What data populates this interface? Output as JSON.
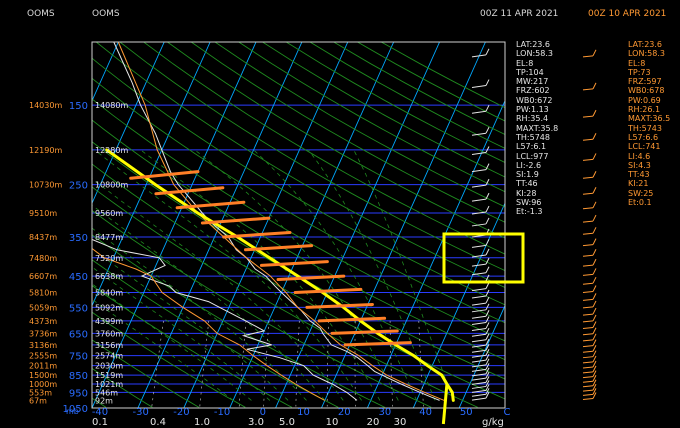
{
  "header": {
    "left_station_1": "OOMS",
    "left_station_2": "OOMS",
    "date_current": "00Z 11 APR 2021",
    "date_previous": "00Z 10 APR 2021"
  },
  "info_current": [
    "LAT:23.6",
    "LON:58.3",
    "EL:8",
    "TP:104",
    "MW:217",
    "FRZ:602",
    "WB0:672",
    "PW:1.13",
    "RH:35.4",
    "MAXT:35.8",
    "TH:5748",
    "L57:6.1",
    "LCL:977",
    "LI:-2.6",
    "SI:1.9",
    "TT:46",
    "KI:28",
    "SW:96",
    "Et:-1.3"
  ],
  "info_previous": [
    "LAT:23.6",
    "LON:58.3",
    "EL:8",
    "TP:73",
    "FRZ:597",
    "WB0:678",
    "PW:0.69",
    "RH:26.1",
    "MAXT:36.5",
    "TH:5743",
    "L57:6.6",
    "LCL:741",
    "LI:4.6",
    "SI:4.3",
    "TT:43",
    "KI:21",
    "SW:25",
    "Et:0.1"
  ],
  "colors": {
    "background": "#000000",
    "isobars": "#2a3cff",
    "isotherms": "#00a8ff",
    "dry_adiabats": "#1f8a1f",
    "moist_adiabats": "#1f8a1f",
    "current_profile": "#e6e6e6",
    "previous_profile": "#ff9933",
    "annotation_curve": "#ffff00",
    "annotation_hatch": "#ff7f27",
    "annotation_box": "#ffff00"
  },
  "chart_data": {
    "type": "line",
    "title": "",
    "pressure_units": "mb",
    "pressure_levels": [
      100,
      150,
      200,
      250,
      300,
      350,
      400,
      450,
      500,
      550,
      600,
      650,
      700,
      750,
      800,
      850,
      900,
      950,
      1050
    ],
    "pressure_labels": [
      {
        "p": 150,
        "label": "150"
      },
      {
        "p": 250,
        "label": "250"
      },
      {
        "p": 350,
        "label": "350"
      },
      {
        "p": 450,
        "label": "450"
      },
      {
        "p": 550,
        "label": "550"
      },
      {
        "p": 650,
        "label": "650"
      },
      {
        "p": 750,
        "label": "750"
      },
      {
        "p": 850,
        "label": "850"
      },
      {
        "p": 950,
        "label": "950"
      },
      {
        "p": 1050,
        "label": "1050"
      }
    ],
    "height_labels_previous": [
      {
        "p": 150,
        "label": "14030m"
      },
      {
        "p": 200,
        "label": "12190m"
      },
      {
        "p": 250,
        "label": "10730m"
      },
      {
        "p": 300,
        "label": "9510m"
      },
      {
        "p": 350,
        "label": "8437m"
      },
      {
        "p": 400,
        "label": "7480m"
      },
      {
        "p": 450,
        "label": "6607m"
      },
      {
        "p": 500,
        "label": "5810m"
      },
      {
        "p": 550,
        "label": "5059m"
      },
      {
        "p": 600,
        "label": "4373m"
      },
      {
        "p": 650,
        "label": "3736m"
      },
      {
        "p": 700,
        "label": "3136m"
      },
      {
        "p": 750,
        "label": "2555m"
      },
      {
        "p": 800,
        "label": "2011m"
      },
      {
        "p": 850,
        "label": "1500m"
      },
      {
        "p": 900,
        "label": "1000m"
      },
      {
        "p": 950,
        "label": "553m"
      },
      {
        "p": 1000,
        "label": "67m"
      }
    ],
    "height_labels_current": [
      {
        "p": 150,
        "label": "14080m"
      },
      {
        "p": 200,
        "label": "12280m"
      },
      {
        "p": 250,
        "label": "10800m"
      },
      {
        "p": 300,
        "label": "9560m"
      },
      {
        "p": 350,
        "label": "8477m"
      },
      {
        "p": 400,
        "label": "7520m"
      },
      {
        "p": 450,
        "label": "6638m"
      },
      {
        "p": 500,
        "label": "5840m"
      },
      {
        "p": 550,
        "label": "5092m"
      },
      {
        "p": 600,
        "label": "4399m"
      },
      {
        "p": 650,
        "label": "3760m"
      },
      {
        "p": 700,
        "label": "3156m"
      },
      {
        "p": 750,
        "label": "2574m"
      },
      {
        "p": 800,
        "label": "2030m"
      },
      {
        "p": 850,
        "label": "1519m"
      },
      {
        "p": 900,
        "label": "1021m"
      },
      {
        "p": 950,
        "label": "546m"
      },
      {
        "p": 1000,
        "label": "92m"
      }
    ],
    "temperature_ticks": [
      "-40",
      "-30",
      "-20",
      "-10",
      "0",
      "10",
      "20",
      "30",
      "40",
      "50",
      "C"
    ],
    "mixing_ratio_ticks": [
      "0.1",
      "0.4",
      "1.0",
      "3.0",
      "5.0",
      "10",
      "20",
      "30"
    ],
    "mixing_ratio_units": "g/kg",
    "temperature_range": [
      -40,
      50
    ],
    "pressure_range": [
      100,
      1050
    ],
    "skew_deg_per_decade": 35,
    "series": [
      {
        "name": "",
        "color_key": "current_profile",
        "kind": "temperature",
        "points": [
          [
            100,
            -71
          ],
          [
            130,
            -63
          ],
          [
            150,
            -59
          ],
          [
            180,
            -53
          ],
          [
            200,
            -50
          ],
          [
            230,
            -46
          ],
          [
            250,
            -43
          ],
          [
            280,
            -38
          ],
          [
            300,
            -35
          ],
          [
            320,
            -32
          ],
          [
            350,
            -27
          ],
          [
            380,
            -24
          ],
          [
            400,
            -21
          ],
          [
            430,
            -18
          ],
          [
            450,
            -15
          ],
          [
            480,
            -12
          ],
          [
            500,
            -10
          ],
          [
            540,
            -6
          ],
          [
            560,
            -4
          ],
          [
            600,
            -1
          ],
          [
            630,
            2
          ],
          [
            650,
            3
          ],
          [
            700,
            6
          ],
          [
            730,
            10
          ],
          [
            760,
            13
          ],
          [
            800,
            16
          ],
          [
            830,
            18
          ],
          [
            850,
            20
          ],
          [
            880,
            23
          ],
          [
            900,
            25
          ],
          [
            930,
            28
          ],
          [
            950,
            30
          ],
          [
            980,
            33
          ],
          [
            1000,
            35
          ]
        ]
      },
      {
        "name": "",
        "color_key": "current_profile",
        "kind": "dewpoint",
        "points": [
          [
            100,
            -94
          ],
          [
            150,
            -90
          ],
          [
            200,
            -82
          ],
          [
            250,
            -72
          ],
          [
            300,
            -66
          ],
          [
            350,
            -58
          ],
          [
            380,
            -50
          ],
          [
            400,
            -40
          ],
          [
            420,
            -38
          ],
          [
            450,
            -42
          ],
          [
            480,
            -35
          ],
          [
            500,
            -33
          ],
          [
            530,
            -25
          ],
          [
            550,
            -22
          ],
          [
            600,
            -15
          ],
          [
            640,
            -10
          ],
          [
            660,
            -14
          ],
          [
            700,
            -7
          ],
          [
            720,
            -12
          ],
          [
            760,
            -4
          ],
          [
            800,
            2
          ],
          [
            850,
            5
          ],
          [
            880,
            8
          ],
          [
            900,
            10
          ],
          [
            950,
            14
          ],
          [
            1000,
            17
          ]
        ]
      },
      {
        "name": "",
        "color_key": "previous_profile",
        "kind": "temperature",
        "points": [
          [
            100,
            -70
          ],
          [
            150,
            -58
          ],
          [
            200,
            -51
          ],
          [
            250,
            -44
          ],
          [
            300,
            -36
          ],
          [
            350,
            -28
          ],
          [
            400,
            -21
          ],
          [
            450,
            -14
          ],
          [
            480,
            -11
          ],
          [
            500,
            -9
          ],
          [
            550,
            -5
          ],
          [
            600,
            0
          ],
          [
            650,
            4
          ],
          [
            700,
            8
          ],
          [
            750,
            13
          ],
          [
            800,
            17
          ],
          [
            850,
            21
          ],
          [
            900,
            26
          ],
          [
            950,
            31
          ],
          [
            1000,
            36
          ]
        ]
      },
      {
        "name": "",
        "color_key": "previous_profile",
        "kind": "dewpoint",
        "points": [
          [
            100,
            -92
          ],
          [
            150,
            -86
          ],
          [
            200,
            -80
          ],
          [
            250,
            -74
          ],
          [
            300,
            -68
          ],
          [
            350,
            -60
          ],
          [
            400,
            -52
          ],
          [
            430,
            -44
          ],
          [
            450,
            -40
          ],
          [
            500,
            -36
          ],
          [
            550,
            -30
          ],
          [
            600,
            -24
          ],
          [
            650,
            -20
          ],
          [
            700,
            -14
          ],
          [
            750,
            -10
          ],
          [
            800,
            -6
          ],
          [
            850,
            -2
          ],
          [
            900,
            2
          ],
          [
            950,
            6
          ],
          [
            1000,
            10
          ]
        ]
      }
    ],
    "grid": true
  }
}
